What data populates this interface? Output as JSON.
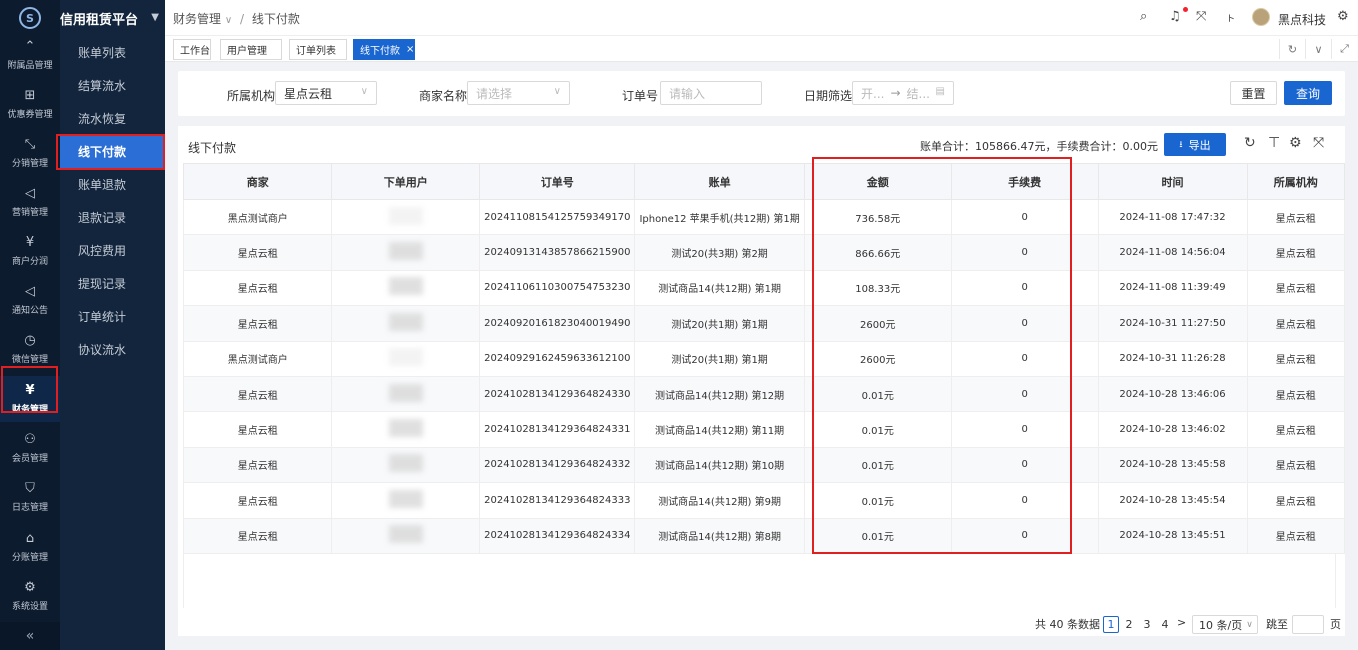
{
  "brand": {
    "title": "信用租赁平台"
  },
  "rail": {
    "items": [
      {
        "label": "附属品管理",
        "icon": "chevron-up-icon",
        "glyph": "⌃"
      },
      {
        "label": "优惠券管理",
        "icon": "gift-icon",
        "glyph": "⊞"
      },
      {
        "label": "分销管理",
        "icon": "share-icon",
        "glyph": "⤡"
      },
      {
        "label": "营销管理",
        "icon": "megaphone-icon",
        "glyph": "◁"
      },
      {
        "label": "商户分润",
        "icon": "yen-icon",
        "glyph": "¥"
      },
      {
        "label": "通知公告",
        "icon": "bell-icon",
        "glyph": "◁"
      },
      {
        "label": "微信管理",
        "icon": "clock-icon",
        "glyph": "◷"
      },
      {
        "label": "财务管理",
        "icon": "wallet-icon",
        "glyph": "¥"
      },
      {
        "label": "会员管理",
        "icon": "members-icon",
        "glyph": "⚇"
      },
      {
        "label": "日志管理",
        "icon": "shield-icon",
        "glyph": "⛉"
      },
      {
        "label": "分账管理",
        "icon": "split-icon",
        "glyph": "⌂"
      },
      {
        "label": "系统设置",
        "icon": "gear-icon",
        "glyph": "⚙"
      }
    ],
    "collapse_glyph": "«"
  },
  "submenu": {
    "items": [
      "账单列表",
      "结算流水",
      "流水恢复",
      "线下付款",
      "账单退款",
      "退款记录",
      "风控费用",
      "提现记录",
      "订单统计",
      "协议流水"
    ]
  },
  "header": {
    "crumb_parent": "财务管理",
    "crumb_parent_caret": "∨",
    "crumb_sep": "/",
    "crumb_current": "线下付款",
    "user_name": "黑点科技"
  },
  "tabs": {
    "items": [
      "工作台",
      "用户管理",
      "订单列表",
      "线下付款"
    ],
    "close_glyph": "×"
  },
  "filter": {
    "org_label": "所属机构",
    "org_value": "星点云租",
    "merchant_label": "商家名称",
    "merchant_placeholder": "请选择",
    "order_label": "订单号",
    "order_placeholder": "请输入",
    "date_label": "日期筛选",
    "date_start_placeholder": "开...",
    "date_arrow": "→",
    "date_end_placeholder": "结...",
    "reset_label": "重置",
    "query_label": "查询"
  },
  "table": {
    "title": "线下付款",
    "summary": "账单合计：105866.47元，手续费合计：0.00元",
    "export_label": "导出",
    "columns": [
      "商家",
      "下单用户",
      "订单号",
      "账单",
      "金额",
      "手续费",
      "时间",
      "所属机构"
    ],
    "rows": [
      {
        "merchant": "黑点测试商户",
        "user": "",
        "order": "20241108154125759349170",
        "bill": "Iphone12 苹果手机(共12期) 第1期",
        "amount": "736.58元",
        "fee": "0",
        "time": "2024-11-08 17:47:32",
        "org": "星点云租"
      },
      {
        "merchant": "星点云租",
        "user": "",
        "order": "20240913143857866215900",
        "bill": "测试20(共3期) 第2期",
        "amount": "866.66元",
        "fee": "0",
        "time": "2024-11-08 14:56:04",
        "org": "星点云租"
      },
      {
        "merchant": "星点云租",
        "user": "",
        "order": "20241106110300754753230",
        "bill": "测试商品14(共12期) 第1期",
        "amount": "108.33元",
        "fee": "0",
        "time": "2024-11-08 11:39:49",
        "org": "星点云租"
      },
      {
        "merchant": "星点云租",
        "user": "",
        "order": "20240920161823040019490",
        "bill": "测试20(共1期) 第1期",
        "amount": "2600元",
        "fee": "0",
        "time": "2024-10-31 11:27:50",
        "org": "星点云租"
      },
      {
        "merchant": "黑点测试商户",
        "user": "",
        "order": "20240929162459633612100",
        "bill": "测试20(共1期) 第1期",
        "amount": "2600元",
        "fee": "0",
        "time": "2024-10-31 11:26:28",
        "org": "星点云租"
      },
      {
        "merchant": "星点云租",
        "user": "",
        "order": "20241028134129364824330",
        "bill": "测试商品14(共12期) 第12期",
        "amount": "0.01元",
        "fee": "0",
        "time": "2024-10-28 13:46:06",
        "org": "星点云租"
      },
      {
        "merchant": "星点云租",
        "user": "",
        "order": "20241028134129364824331",
        "bill": "测试商品14(共12期) 第11期",
        "amount": "0.01元",
        "fee": "0",
        "time": "2024-10-28 13:46:02",
        "org": "星点云租"
      },
      {
        "merchant": "星点云租",
        "user": "",
        "order": "20241028134129364824332",
        "bill": "测试商品14(共12期) 第10期",
        "amount": "0.01元",
        "fee": "0",
        "time": "2024-10-28 13:45:58",
        "org": "星点云租"
      },
      {
        "merchant": "星点云租",
        "user": "",
        "order": "20241028134129364824333",
        "bill": "测试商品14(共12期) 第9期",
        "amount": "0.01元",
        "fee": "0",
        "time": "2024-10-28 13:45:54",
        "org": "星点云租"
      },
      {
        "merchant": "星点云租",
        "user": "",
        "order": "20241028134129364824334",
        "bill": "测试商品14(共12期) 第8期",
        "amount": "0.01元",
        "fee": "0",
        "time": "2024-10-28 13:45:51",
        "org": "星点云租"
      }
    ]
  },
  "pagination": {
    "total_text": "共 40 条数据",
    "pages": [
      "1",
      "2",
      "3",
      "4"
    ],
    "current": "1",
    "next_glyph": ">",
    "page_size": "10 条/页",
    "jump_label": "跳至",
    "page_unit": "页"
  },
  "colors": {
    "accent": "#1a66d0",
    "sidebar": "#0d1b2e",
    "submenu": "#13253c",
    "highlight": "#e02020"
  }
}
